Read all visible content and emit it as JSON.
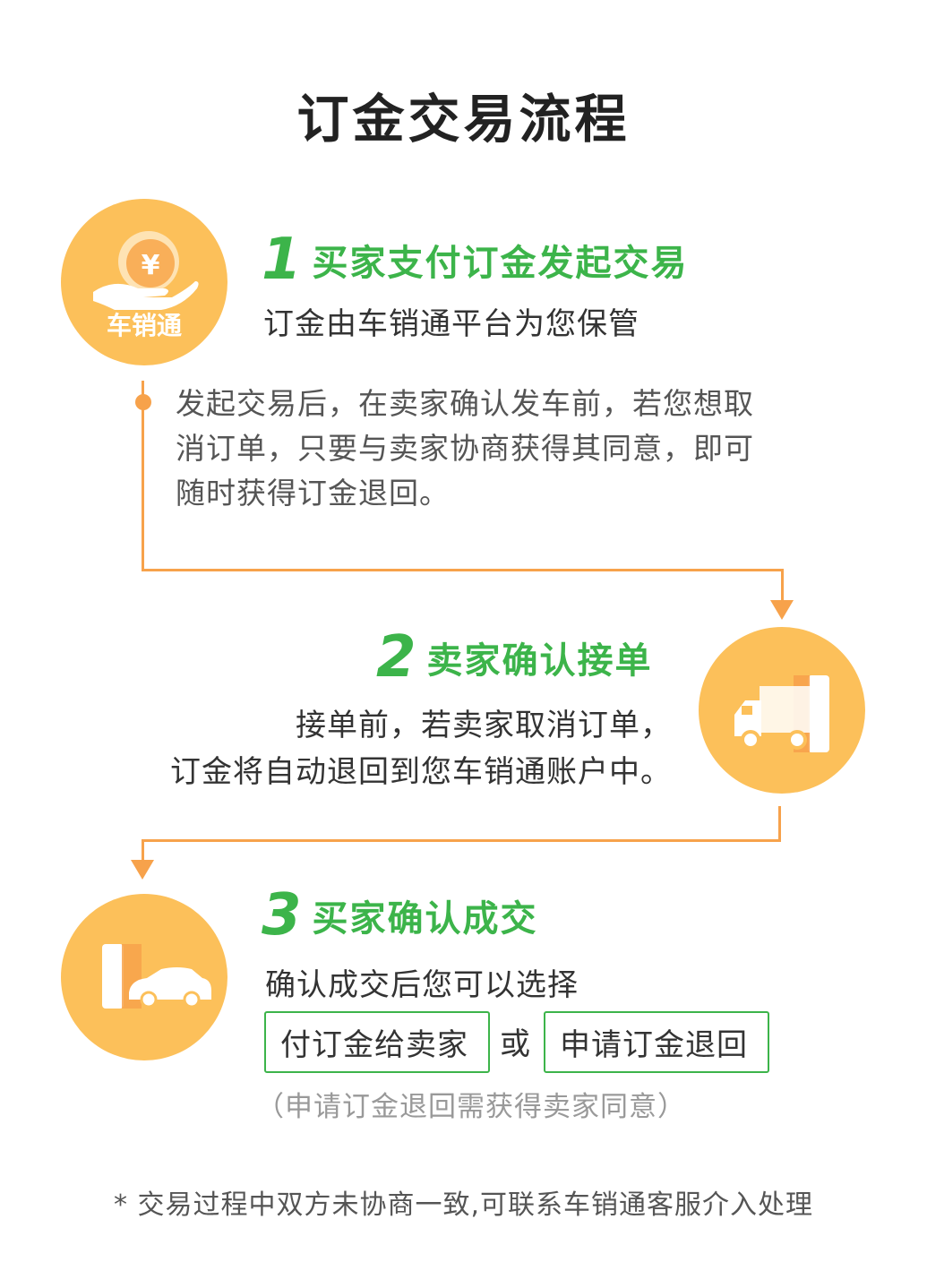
{
  "title": "订金交易流程",
  "colors": {
    "accent_green": "#3cb44a",
    "accent_orange": "#f7a24b",
    "circle": "#fcc05a"
  },
  "step1": {
    "num": "1",
    "heading": "买家支付订金发起交易",
    "sub": "订金由车销通平台为您保管",
    "icon": "money-hand-icon",
    "icon_label": "车销通",
    "para": [
      "发起交易后，在卖家确认发车前，若您想取",
      "消订单，只要与卖家协商获得其同意，即可",
      "随时获得订金退回。"
    ]
  },
  "step2": {
    "num": "2",
    "heading": "卖家确认接单",
    "icon": "truck-icon",
    "lines": [
      "接单前，若卖家取消订单，",
      "订金将自动退回到您车销通账户中。"
    ]
  },
  "step3": {
    "num": "3",
    "heading": "买家确认成交",
    "icon": "car-icon",
    "sub": "确认成交后您可以选择",
    "option1": "付订金给卖家",
    "or": "或",
    "option2": "申请订金退回",
    "note": "（申请订金退回需获得卖家同意）"
  },
  "footer": "* 交易过程中双方未协商一致,可联系车销通客服介入处理"
}
